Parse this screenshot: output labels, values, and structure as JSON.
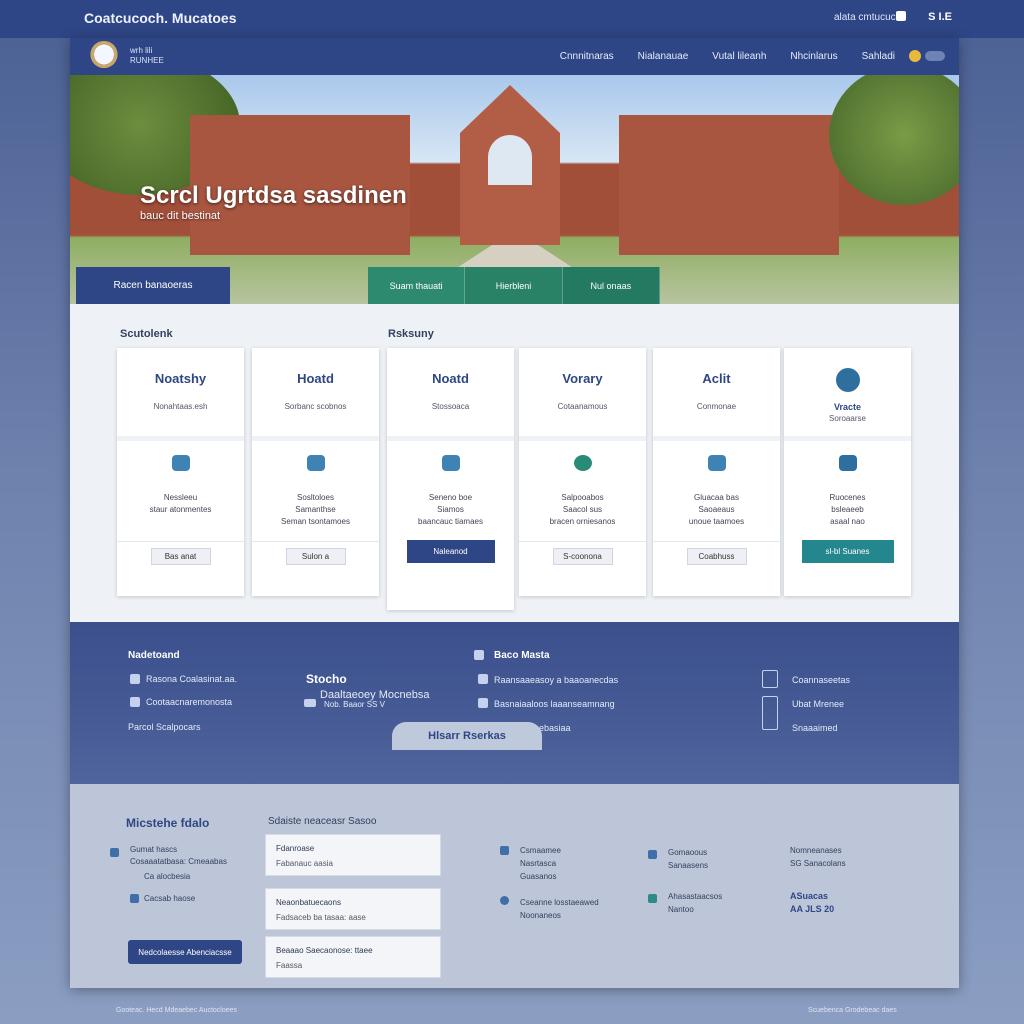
{
  "topbar": {
    "brand": "Coatcucoch. Mucatoes",
    "meta": "alata cmtucuc.e",
    "lang": "S I.E"
  },
  "nav": {
    "logo_text": "wrh lili\nRUNHEE",
    "links": [
      "Cnnnitnaras",
      "Nialanauae",
      "Vutal lileanh",
      "Nhcinlarus",
      "Sahladi"
    ]
  },
  "hero": {
    "title": "Scrcl Ugrtdsa sasdinen",
    "subtitle": "bauc dit bestinat",
    "button": "Racen banaoeras",
    "tabs": [
      "Suam thauati",
      "Hierbleni",
      "Nul onaas"
    ]
  },
  "sections": {
    "left_label": "Scutolenk",
    "right_label": "Rsksuny"
  },
  "cards": [
    {
      "title": "Noatshy",
      "sub": "Nonahtaas.esh",
      "detail": "Nessleeu\nstaur atonmentes",
      "button": "Bas anat",
      "style": "default"
    },
    {
      "title": "Hoatd",
      "sub": "Sorbanc scobnos",
      "detail": "Sosltoloes\nSamanthse\nSeman tsontamoes",
      "button": "Sulon a",
      "style": "default"
    },
    {
      "title": "Noatd",
      "sub": "Stossoaca",
      "detail": "Seneno boe\nSiamos\nbaancauc tiamaes",
      "button": "Naleanod",
      "style": "primary"
    },
    {
      "title": "Vorary",
      "sub": "Cotaanamous",
      "detail": "Salpooabos\nSaacol sus\nbracen orniesanos",
      "button": "S-coonona",
      "style": "default"
    },
    {
      "title": "Aclit",
      "sub": "Conmonae",
      "detail": "Gluacaa bas\nSaoaeaus\nunoue taamoes",
      "button": "Coabhuss",
      "style": "default"
    },
    {
      "title": "Vracte",
      "sub": "Soroaarse",
      "detail": "Ruocenes\nbsleaeeb\nasaal nao",
      "button": "sl-bl Suanes",
      "style": "teal"
    }
  ],
  "info": {
    "col1_heading": "Nadetoand",
    "col1_items": [
      "Rasona Coalasinat.aa.",
      "Cootaacnaremonosta",
      "Parcol Scalpocars"
    ],
    "col2_heading": "Stocho",
    "col2_sub": "Daaltaeoey Mocnebsa",
    "col2_sub2": "Nob. Baaor SS V",
    "col3_heading": "Baco Masta",
    "col3_items": [
      "Raansaaeasoy a baaoanecdas",
      "Basnaiaaloos laaanseamnang",
      "Casnensceebasiaa"
    ],
    "col4_items": [
      "Coannaseetas",
      "Ubat Mrenee",
      "Snaaaimed"
    ]
  },
  "bubble": "Hlsarr Rserkas",
  "footer": {
    "contact_heading": "Micstehe fdalo",
    "contact_items": [
      "Gumat hascs\nCosaaatatbasa: Cmeaabas",
      "Ca alocbesia",
      "Cacsab haose"
    ],
    "form_heading": "Sdaiste neaceasr Sasoo",
    "forms": [
      {
        "a": "Fdanroase",
        "b": "Fabanauc aasia"
      },
      {
        "a": "Neaonbatuecaons",
        "b": "Fadsaceb ba tasaa: aase"
      },
      {
        "a": "Beaaao Saecaonose: ttaee",
        "b": "Faassa"
      }
    ],
    "button": "Nedcolaesse Abenciacsse",
    "col3": [
      "Csmaamee\nNasrtasca\nGuasanos",
      "Cseanne losstaeawed\nNoonaneos"
    ],
    "col4": [
      "Gomaoous\nSanaasens",
      "Ahasastaacsos\nNantoo"
    ],
    "col5": [
      "Nomneanases\nSG Sanacolans",
      "ASuacas\nAA JLS 20"
    ]
  },
  "bottom": {
    "left": "Gooteac. Hecd Mdeaebec Auctocloees",
    "right": "Scuebenca Grodebeac daes"
  }
}
